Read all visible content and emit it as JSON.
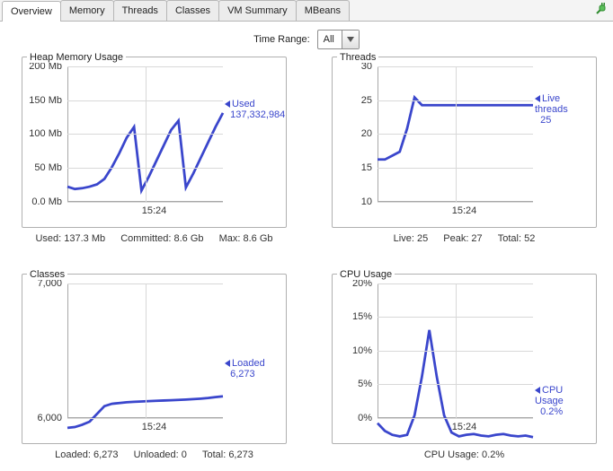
{
  "tabs": {
    "overview": "Overview",
    "memory": "Memory",
    "threads": "Threads",
    "classes": "Classes",
    "vm_summary": "VM Summary",
    "mbeans": "MBeans",
    "active": "overview"
  },
  "time_range": {
    "label": "Time Range:",
    "value": "All"
  },
  "panels": {
    "heap": {
      "title": "Heap Memory Usage",
      "summary": {
        "used": "Used: 137.3 Mb",
        "committed": "Committed: 8.6 Gb",
        "max": "Max: 8.6 Gb"
      },
      "legend": {
        "name": "Used",
        "value": "137,332,984"
      }
    },
    "threads": {
      "title": "Threads",
      "summary": {
        "live": "Live: 25",
        "peak": "Peak: 27",
        "total": "Total: 52"
      },
      "legend": {
        "name": "Live threads",
        "value": "25"
      }
    },
    "classes": {
      "title": "Classes",
      "summary": {
        "loaded": "Loaded: 6,273",
        "unloaded": "Unloaded: 0",
        "total": "Total: 6,273"
      },
      "legend": {
        "name": "Loaded",
        "value": "6,273"
      }
    },
    "cpu": {
      "title": "CPU Usage",
      "summary": {
        "usage": "CPU Usage: 0.2%"
      },
      "legend": {
        "name": "CPU Usage",
        "value": "0.2%"
      }
    }
  },
  "axes": {
    "heap_y": [
      "0.0 Mb",
      "50 Mb",
      "100 Mb",
      "150 Mb",
      "200 Mb"
    ],
    "threads_y": [
      "10",
      "15",
      "20",
      "25",
      "30"
    ],
    "classes_y": [
      "6,000",
      "7,000"
    ],
    "cpu_y": [
      "0%",
      "5%",
      "10%",
      "15%",
      "20%"
    ],
    "x_tick": "15:24"
  },
  "chart_data": [
    {
      "type": "line",
      "title": "Heap Memory Usage",
      "ylabel": "Mb",
      "ylim": [
        0,
        200
      ],
      "x_tick": "15:24",
      "series": [
        {
          "name": "Used",
          "values": [
            45,
            42,
            43,
            45,
            48,
            55,
            70,
            88,
            108,
            122,
            40,
            58,
            78,
            98,
            118,
            130,
            44,
            62,
            82,
            102,
            122,
            140
          ]
        }
      ]
    },
    {
      "type": "line",
      "title": "Threads",
      "ylabel": "threads",
      "ylim": [
        10,
        30
      ],
      "x_tick": "15:24",
      "series": [
        {
          "name": "Live threads",
          "values": [
            18,
            18,
            18.5,
            19,
            22,
            26,
            25,
            25,
            25,
            25,
            25,
            25,
            25,
            25,
            25,
            25,
            25,
            25,
            25,
            25,
            25,
            25
          ]
        }
      ]
    },
    {
      "type": "line",
      "title": "Classes",
      "ylabel": "classes",
      "ylim": [
        6000,
        7000
      ],
      "x_tick": "15:24",
      "series": [
        {
          "name": "Loaded",
          "values": [
            6070,
            6075,
            6090,
            6110,
            6160,
            6210,
            6225,
            6230,
            6235,
            6238,
            6240,
            6242,
            6244,
            6246,
            6248,
            6250,
            6252,
            6255,
            6258,
            6262,
            6268,
            6273
          ]
        }
      ]
    },
    {
      "type": "line",
      "title": "CPU Usage",
      "ylabel": "%",
      "ylim": [
        0,
        20
      ],
      "x_tick": "15:24",
      "series": [
        {
          "name": "CPU Usage",
          "values": [
            2,
            1,
            0.5,
            0.3,
            0.5,
            3,
            8,
            14,
            8,
            3,
            0.8,
            0.3,
            0.5,
            0.6,
            0.4,
            0.3,
            0.5,
            0.6,
            0.4,
            0.3,
            0.4,
            0.2
          ]
        }
      ]
    }
  ]
}
